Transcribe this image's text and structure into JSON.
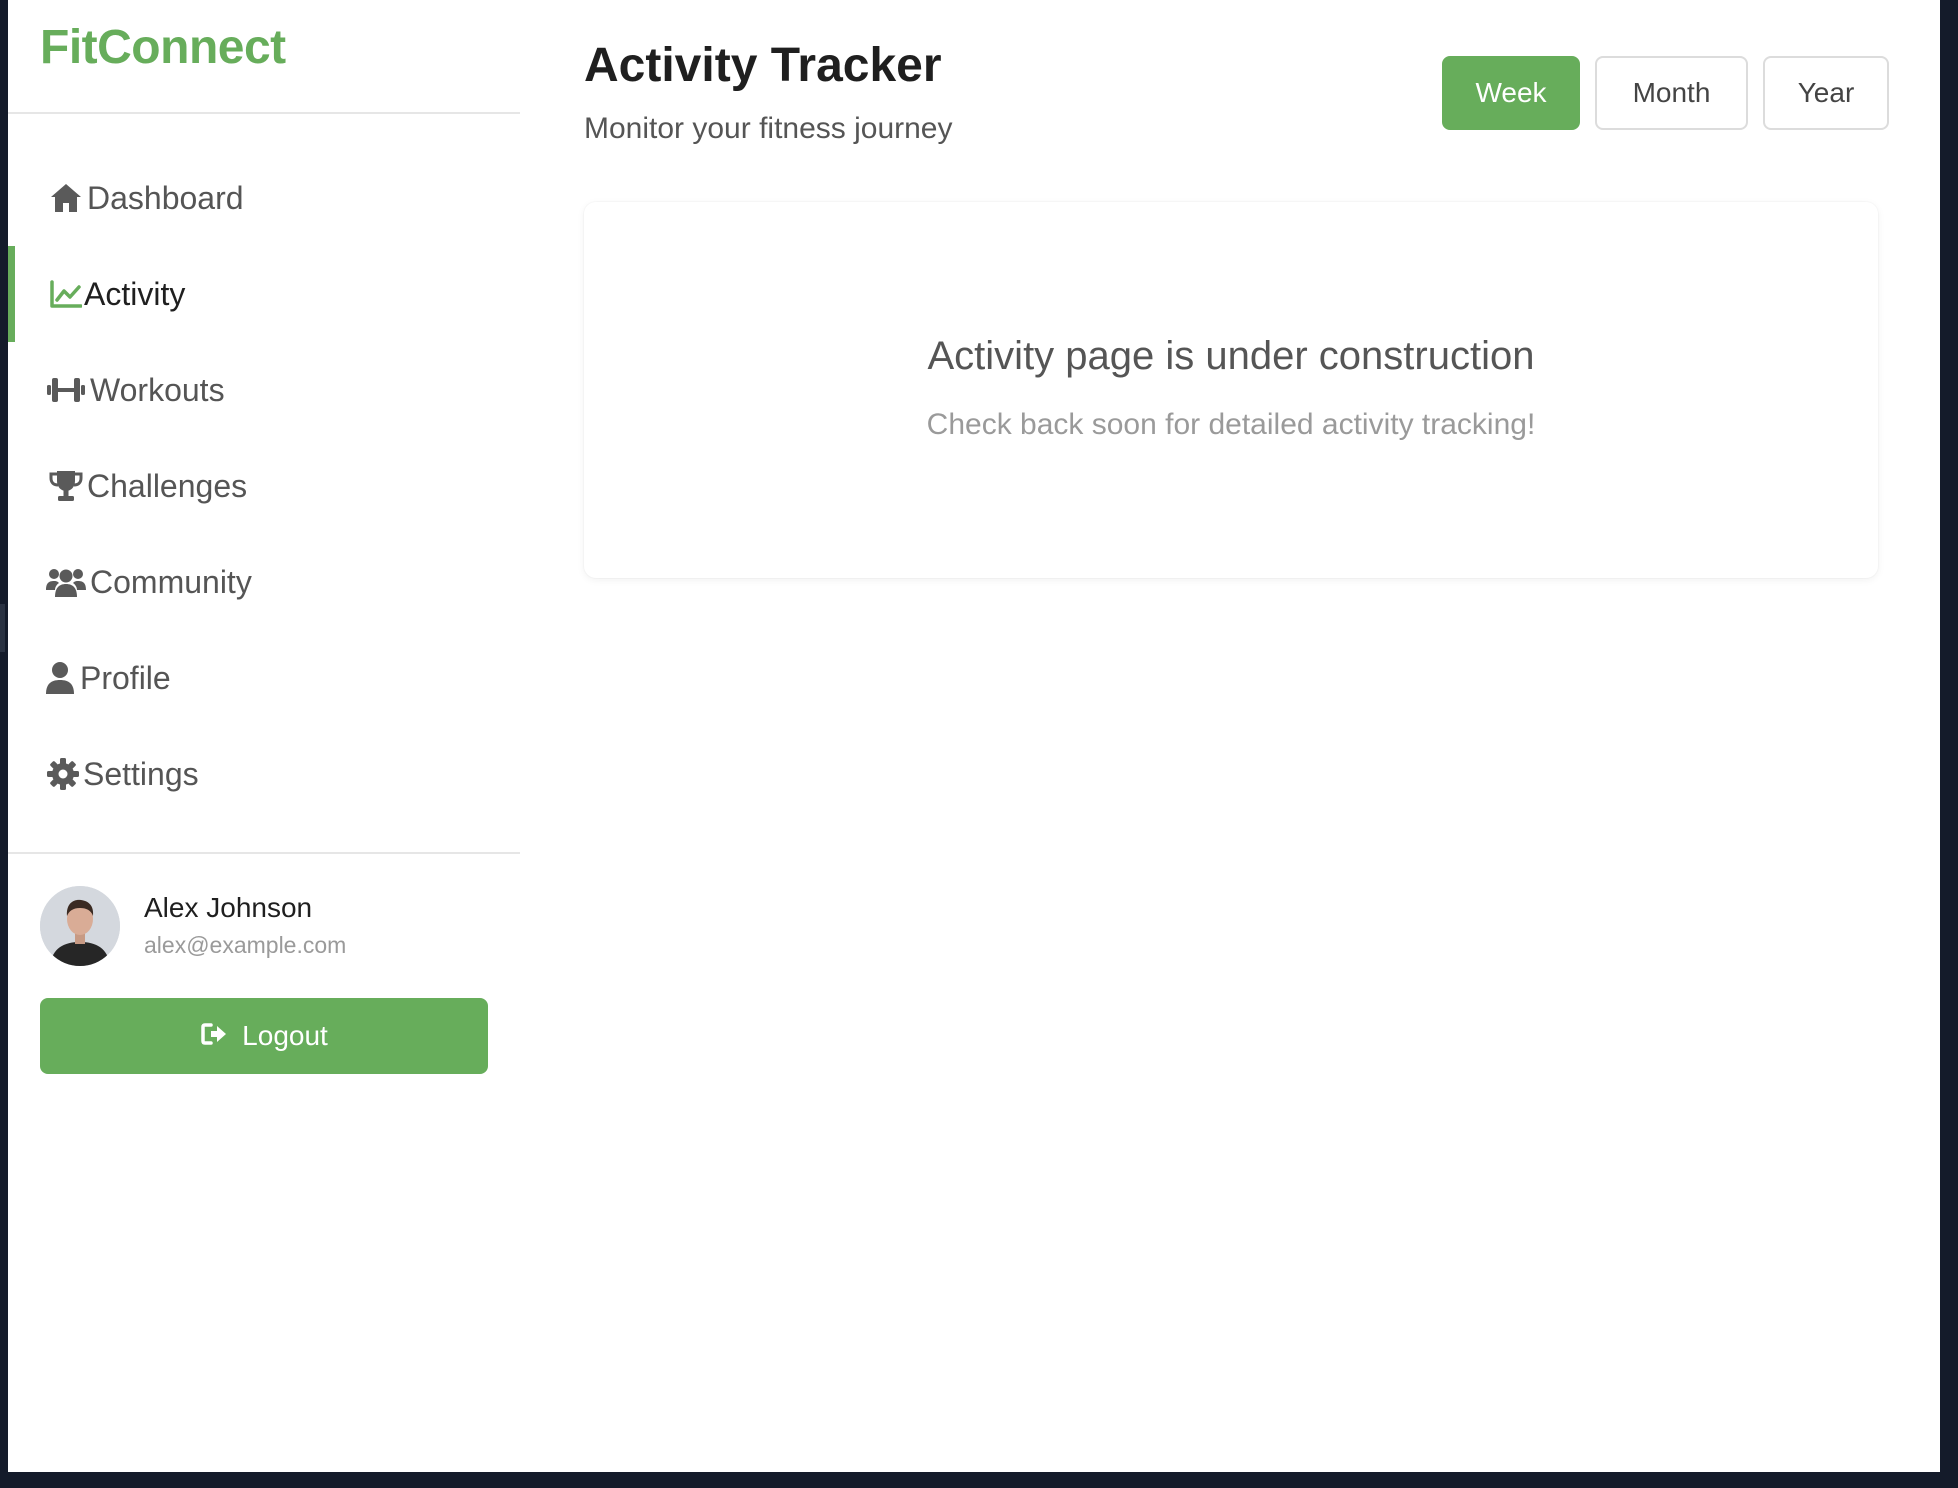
{
  "app": {
    "brand": "FitConnect"
  },
  "sidebar": {
    "items": [
      {
        "label": "Dashboard",
        "icon": "home-icon",
        "active": false
      },
      {
        "label": "Activity",
        "icon": "chart-line-icon",
        "active": true
      },
      {
        "label": "Workouts",
        "icon": "dumbbell-icon",
        "active": false
      },
      {
        "label": "Challenges",
        "icon": "trophy-icon",
        "active": false
      },
      {
        "label": "Community",
        "icon": "users-icon",
        "active": false
      },
      {
        "label": "Profile",
        "icon": "user-icon",
        "active": false
      },
      {
        "label": "Settings",
        "icon": "gear-icon",
        "active": false
      }
    ]
  },
  "user": {
    "name": "Alex Johnson",
    "email": "alex@example.com",
    "logout_label": "Logout"
  },
  "header": {
    "title": "Activity Tracker",
    "subtitle": "Monitor your fitness journey"
  },
  "range_tabs": [
    {
      "label": "Week",
      "active": true
    },
    {
      "label": "Month",
      "active": false
    },
    {
      "label": "Year",
      "active": false
    }
  ],
  "placeholder": {
    "title": "Activity page is under construction",
    "message": "Check back soon for detailed activity tracking!"
  },
  "colors": {
    "accent": "#67ad5b",
    "text_primary": "#1f1f1f",
    "text_secondary": "#555555",
    "text_muted": "#9a9a9a",
    "background_frame": "#141b2a"
  }
}
